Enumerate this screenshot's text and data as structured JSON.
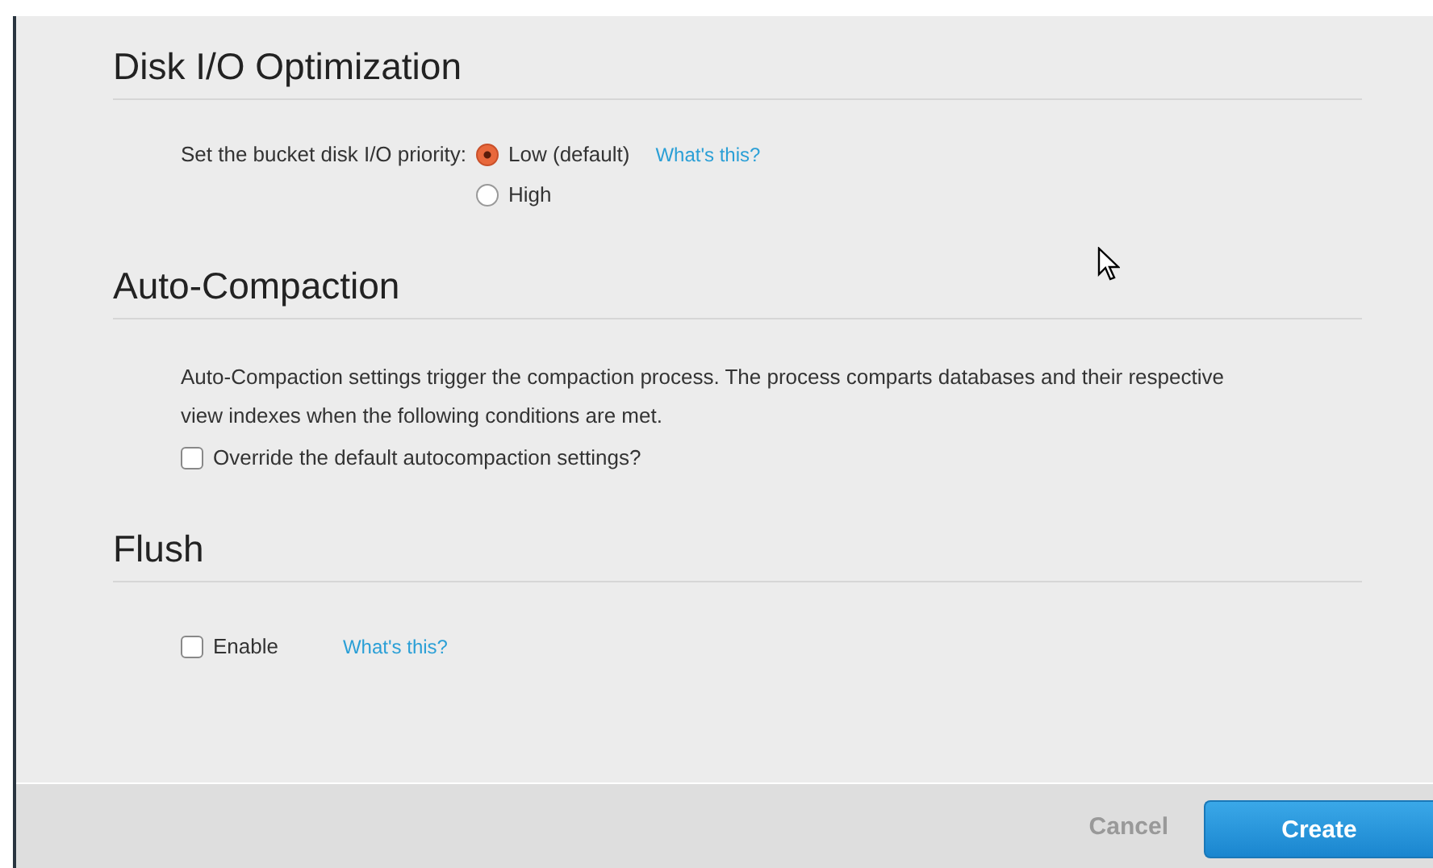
{
  "sections": [
    {
      "kind": "radio",
      "title": "Disk I/O Optimization",
      "label": "Set the bucket disk I/O priority:",
      "options": [
        {
          "label": "Low (default)",
          "selected": true
        },
        {
          "label": "High",
          "selected": false
        }
      ],
      "help": "What's this?"
    },
    {
      "kind": "text-check",
      "title": "Auto-Compaction",
      "text": "Auto-Compaction settings trigger the compaction process. The process comparts databases and their respective view indexes when the following conditions are met.",
      "checkbox": {
        "label": "Override the default autocompaction settings?",
        "checked": false
      }
    },
    {
      "kind": "check-help",
      "title": "Flush",
      "checkbox": {
        "label": "Enable",
        "checked": false
      },
      "help": "What's this?"
    }
  ],
  "footer": {
    "cancel": "Cancel",
    "create": "Create"
  }
}
